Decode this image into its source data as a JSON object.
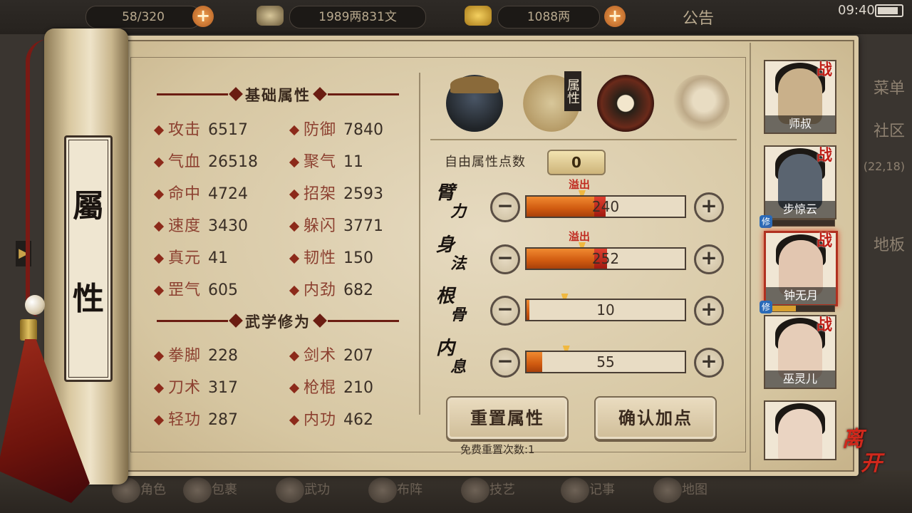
{
  "topbar": {
    "stamina": "58/320",
    "silver": "1989两831文",
    "gold": "1088两",
    "notice": "公告",
    "time": "09:40"
  },
  "bg_sidebar": [
    "菜单",
    "社区",
    "(22,18)",
    "地板"
  ],
  "bottom_nav": [
    "角色",
    "包裹",
    "武功",
    "布阵",
    "技艺",
    "记事",
    "地图"
  ],
  "page_title": [
    "屬",
    "性"
  ],
  "basic": {
    "title": "基础属性",
    "stats": [
      {
        "label": "攻击",
        "value": "6517"
      },
      {
        "label": "防御",
        "value": "7840"
      },
      {
        "label": "气血",
        "value": "26518"
      },
      {
        "label": "聚气",
        "value": "11"
      },
      {
        "label": "命中",
        "value": "4724"
      },
      {
        "label": "招架",
        "value": "2593"
      },
      {
        "label": "速度",
        "value": "3430"
      },
      {
        "label": "躲闪",
        "value": "3771"
      },
      {
        "label": "真元",
        "value": "41"
      },
      {
        "label": "韧性",
        "value": "150"
      },
      {
        "label": "罡气",
        "value": "605"
      },
      {
        "label": "内劲",
        "value": "682"
      }
    ]
  },
  "martial": {
    "title": "武学修为",
    "stats": [
      {
        "label": "拳脚",
        "value": "228"
      },
      {
        "label": "剑术",
        "value": "207"
      },
      {
        "label": "刀术",
        "value": "317"
      },
      {
        "label": "枪棍",
        "value": "210"
      },
      {
        "label": "轻功",
        "value": "287"
      },
      {
        "label": "内功",
        "value": "462"
      }
    ]
  },
  "tabs": {
    "items": [
      "hat-warrior-icon",
      "attribute-scroll-icon",
      "bagua-icon",
      "meridian-body-icon"
    ],
    "active_label": "属性"
  },
  "free_points": {
    "label": "自由属性点数",
    "value": "0"
  },
  "attributes": [
    {
      "name": [
        "臂",
        "力"
      ],
      "value": "240",
      "overflow_label": "溢出",
      "fill": 0.43,
      "over": 0.07,
      "marker": 0.36
    },
    {
      "name": [
        "身",
        "法"
      ],
      "value": "252",
      "overflow_label": "溢出",
      "fill": 0.43,
      "over": 0.08,
      "marker": 0.36
    },
    {
      "name": [
        "根",
        "骨"
      ],
      "value": "10",
      "overflow_label": "",
      "fill": 0.02,
      "over": 0,
      "marker": 0.25
    },
    {
      "name": [
        "内",
        "息"
      ],
      "value": "55",
      "overflow_label": "",
      "fill": 0.1,
      "over": 0,
      "marker": 0.26
    }
  ],
  "buttons": {
    "reset": "重置属性",
    "confirm": "确认加点",
    "reset_count": "免费重置次数:1"
  },
  "characters": [
    {
      "name": "师叔",
      "tag": "战",
      "xp": null,
      "selected": false
    },
    {
      "name": "步惊云",
      "tag": "战",
      "xp": 0.1,
      "selected": false
    },
    {
      "name": "钟无月",
      "tag": "战",
      "xp": 0.45,
      "selected": true
    },
    {
      "name": "巫灵儿",
      "tag": "战",
      "xp": null,
      "selected": false
    },
    {
      "name": "",
      "tag": "",
      "xp": null,
      "selected": false
    }
  ],
  "xp_tag": "修",
  "leave": [
    "离",
    "开"
  ],
  "colors": {
    "accent": "#c02018",
    "bar_fill": "#d05a10",
    "parchment": "#d9c8a4"
  }
}
